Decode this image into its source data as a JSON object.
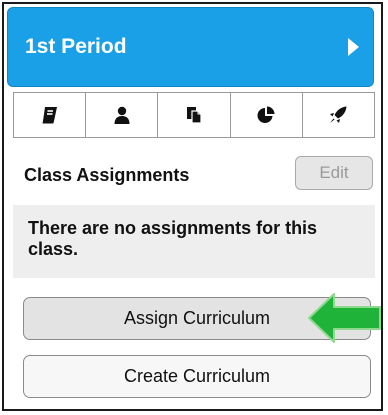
{
  "header": {
    "title": "1st Period",
    "arrow_icon": "caret-right-icon"
  },
  "tabs": [
    {
      "icon": "book-icon"
    },
    {
      "icon": "user-icon"
    },
    {
      "icon": "documents-icon"
    },
    {
      "icon": "pie-chart-icon"
    },
    {
      "icon": "rocket-icon"
    }
  ],
  "section": {
    "title": "Class Assignments",
    "edit_label": "Edit"
  },
  "empty_state": {
    "message": "There are no assignments for this class."
  },
  "buttons": {
    "assign_label": "Assign Curriculum",
    "create_label": "Create Curriculum"
  },
  "colors": {
    "header_bg": "#1aa0e6",
    "arrow_green": "#1fb33a"
  }
}
